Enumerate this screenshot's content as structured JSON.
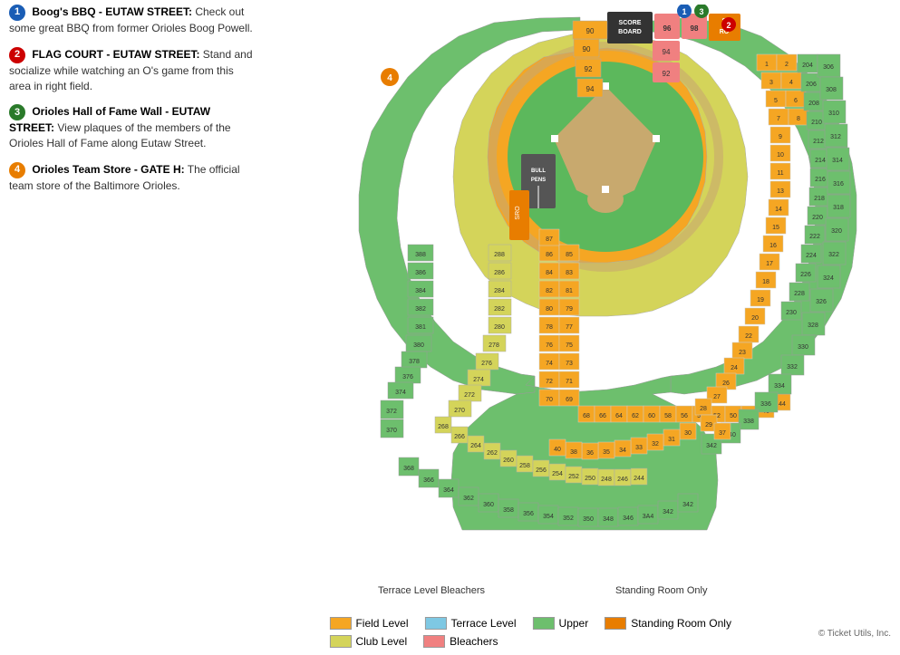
{
  "info_items": [
    {
      "badge": "1",
      "badge_color": "blue",
      "title": "Boog's BBQ",
      "subtitle": " - EUTAW STREET:",
      "desc": " Check out some great BBQ from former Orioles Boog Powell."
    },
    {
      "badge": "2",
      "badge_color": "red",
      "title": "FLAG COURT",
      "subtitle": " - EUTAW STREET:",
      "desc": " Stand and socialize while watching an O's game from this area in right field."
    },
    {
      "badge": "3",
      "badge_color": "green",
      "title": "Orioles Hall of Fame Wall",
      "subtitle": " - EUTAW STREET:",
      "desc": " View plaques of the members of the Orioles Hall of Fame along Eutaw Street."
    },
    {
      "badge": "4",
      "badge_color": "orange",
      "title": "Orioles Team Store",
      "subtitle": " - GATE H:",
      "desc": " The official team store of the Baltimore Orioles."
    }
  ],
  "legend": {
    "items": [
      {
        "label": "Field Level",
        "color": "#f5a623"
      },
      {
        "label": "Terrace Level",
        "color": "#7ec8e3"
      },
      {
        "label": "Upper",
        "color": "#7bc47b"
      },
      {
        "label": "Standing Room Only",
        "color": "#e87d00"
      },
      {
        "label": "Club Level",
        "color": "#e8e87b"
      },
      {
        "label": "Bleachers",
        "color": "#f08080"
      }
    ]
  },
  "copyright": "© Ticket Utils, Inc."
}
